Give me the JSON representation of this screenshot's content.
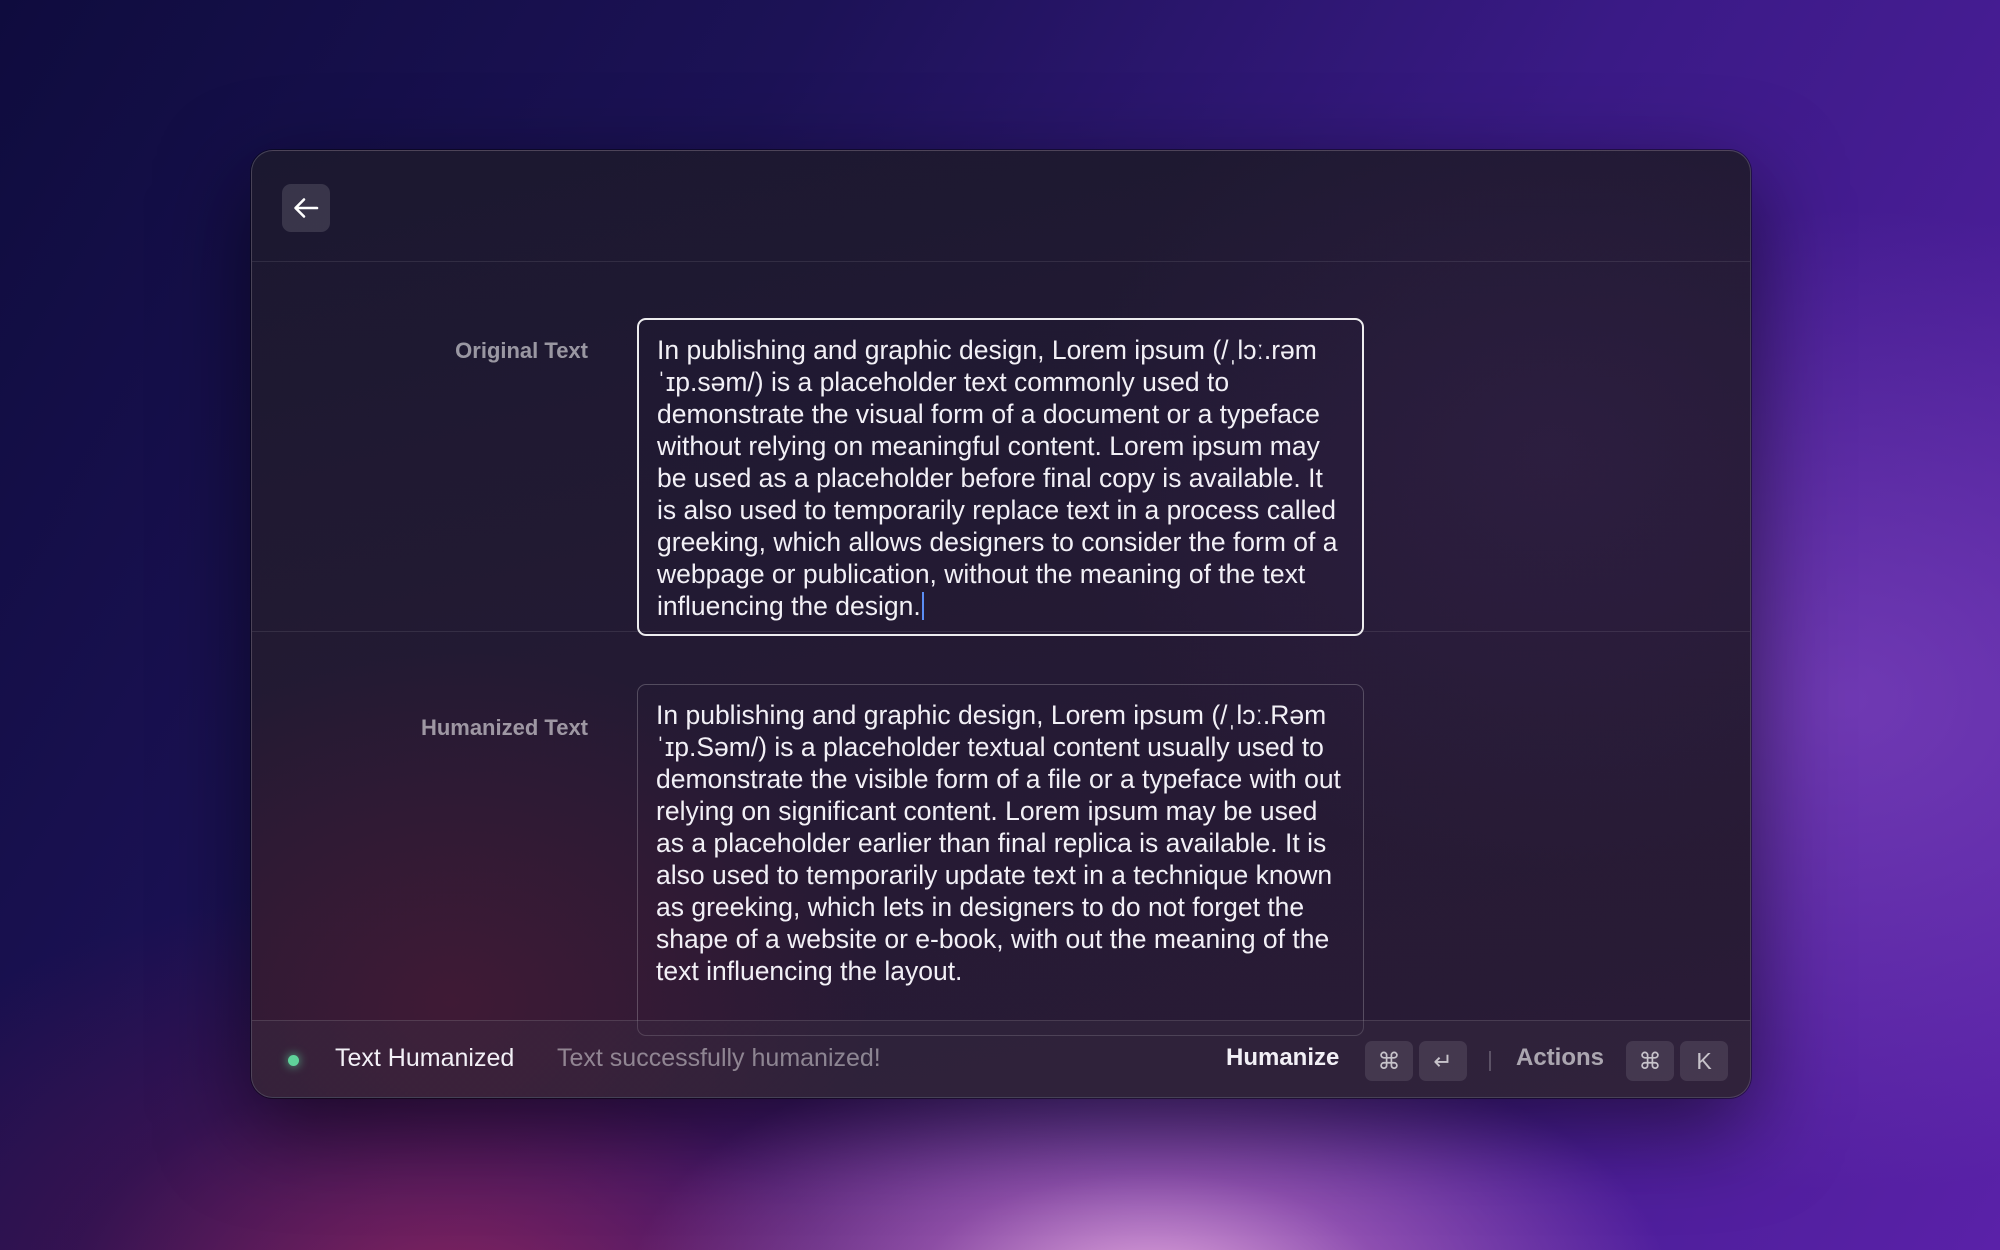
{
  "header": {
    "back_icon": "arrow-left-icon"
  },
  "original": {
    "label": "Original Text",
    "value": "In publishing and graphic design, Lorem ipsum (/ˌlɔː.rəm ˈɪp.səm/) is a placeholder text commonly used to demonstrate the visual form of a document or a typeface without relying on meaningful content. Lorem ipsum may be used as a placeholder before final copy is available. It is also used to temporarily replace text in a process called greeking, which allows designers to consider the form of a webpage or publication, without the meaning of the text influencing the design."
  },
  "humanized": {
    "label": "Humanized Text",
    "value": "In publishing and graphic design, Lorem ipsum (/ˌlɔː.Rəm ˈɪp.Səm/) is a placeholder textual content usually used to demonstrate the visible form of a file or a typeface with out relying on significant content. Lorem ipsum may be used as a placeholder earlier than final replica is available. It is also used to temporarily update text in a technique known as greeking, which lets in designers to do not forget the shape of a website or e-book, with out the meaning of the text influencing the layout."
  },
  "footer": {
    "status_title": "Text Humanized",
    "status_message": "Text successfully humanized!",
    "status_color": "#5fd39a",
    "primary_action": "Humanize",
    "primary_shortcut": [
      "⌘",
      "↵"
    ],
    "secondary_action": "Actions",
    "secondary_shortcut": [
      "⌘",
      "K"
    ]
  }
}
